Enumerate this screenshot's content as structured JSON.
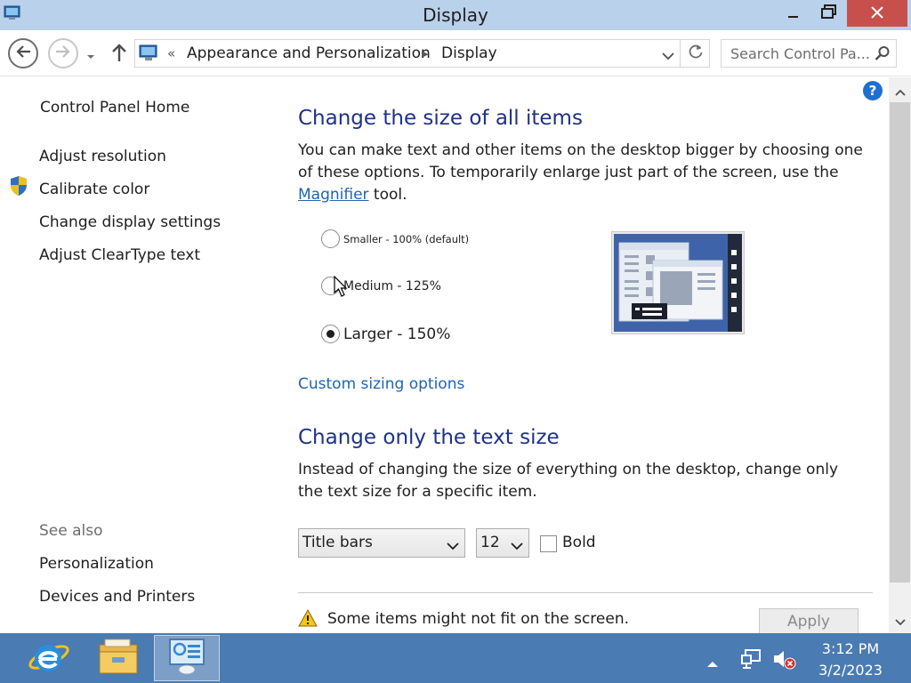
{
  "window": {
    "title": "Display",
    "icon": "control-panel-icon",
    "controls": [
      "minimize-icon",
      "maximize-icon",
      "close-icon"
    ],
    "close_color": "#c7504c",
    "titlebar_color": "#b9d1ea"
  },
  "address_bar": {
    "overflow_marker": "«",
    "breadcrumbs": [
      {
        "label": "Appearance and Personalization"
      },
      {
        "label": "Display"
      }
    ],
    "separator": "▸"
  },
  "search": {
    "placeholder": "Search Control Pa..."
  },
  "left_pane": {
    "home": "Control Panel Home",
    "links": [
      {
        "label": "Adjust resolution"
      },
      {
        "label": "Calibrate color",
        "icon": "uac-shield-icon"
      },
      {
        "label": "Change display settings"
      },
      {
        "label": "Adjust ClearType text"
      }
    ],
    "see_also": {
      "heading": "See also",
      "links": [
        {
          "label": "Personalization"
        },
        {
          "label": "Devices and Printers"
        }
      ]
    }
  },
  "main": {
    "size_section": {
      "heading": "Change the size of all items",
      "description_before": "You can make text and other items on the desktop bigger by choosing one of these options. To temporarily enlarge just part of the screen, use the ",
      "magnifier_link": "Magnifier",
      "description_after": " tool.",
      "options": [
        {
          "label": "Smaller - 100% (default)",
          "checked": false
        },
        {
          "label": "Medium - 125%",
          "checked": false
        },
        {
          "label": "Larger - 150%",
          "checked": true
        }
      ],
      "custom_link": "Custom sizing options"
    },
    "text_section": {
      "heading": "Change only the text size",
      "description": "Instead of changing the size of everything on the desktop, change only the text size for a specific item.",
      "item_select": {
        "value": "Title bars"
      },
      "size_select": {
        "value": "12"
      },
      "bold_checkbox": {
        "label": "Bold",
        "checked": false
      }
    },
    "warning": {
      "icon": "warning-icon",
      "text": "Some items might not fit on the screen."
    },
    "apply_label": "Apply",
    "accent_color": "#1e3287",
    "link_color": "#1e64b4"
  },
  "taskbar": {
    "color": "#4a7bb2",
    "apps": [
      {
        "name": "internet-explorer-icon"
      },
      {
        "name": "file-explorer-icon"
      },
      {
        "name": "control-panel-icon",
        "active": true
      }
    ],
    "tray": {
      "icons": [
        "show-hidden-icons-icon",
        "network-icon",
        "volume-muted-icon"
      ],
      "time": "3:12 PM",
      "date": "3/2/2023"
    }
  }
}
